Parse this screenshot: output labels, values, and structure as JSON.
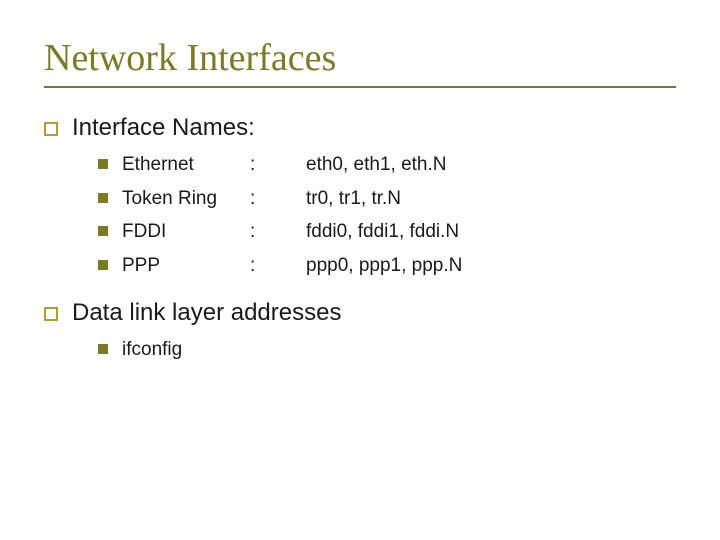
{
  "title": "Network Interfaces",
  "section1": {
    "heading": "Interface Names:",
    "items": [
      {
        "name": "Ethernet",
        "sep": ":",
        "values": "eth0, eth1, eth.N"
      },
      {
        "name": "Token Ring",
        "sep": ":",
        "values": "tr0, tr1, tr.N"
      },
      {
        "name": "FDDI",
        "sep": ":",
        "values": "fddi0, fddi1, fddi.N"
      },
      {
        "name": "PPP",
        "sep": ":",
        "values": "ppp0, ppp1, ppp.N"
      }
    ]
  },
  "section2": {
    "heading": "Data link layer addresses",
    "items": [
      {
        "name": "ifconfig"
      }
    ]
  }
}
